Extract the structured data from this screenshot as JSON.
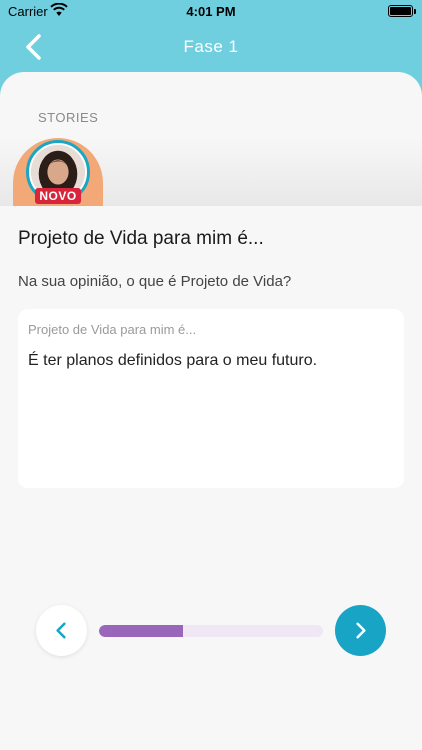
{
  "status_bar": {
    "carrier": "Carrier",
    "time": "4:01 PM"
  },
  "nav": {
    "title": "Fase 1",
    "back_icon": "chevron-left-icon"
  },
  "stories": {
    "label": "STORIES",
    "items": [
      {
        "badge": "NOVO"
      }
    ]
  },
  "question": {
    "title": "Projeto de Vida para mim é...",
    "subtitle": "Na sua opinião, o que é Projeto de Vida?"
  },
  "answer": {
    "placeholder": "Projeto de Vida para mim é...",
    "value": "É ter planos definidos para o meu futuro."
  },
  "footer": {
    "progress": 0.375,
    "prev_icon": "chevron-left-icon",
    "next_icon": "chevron-right-icon"
  },
  "colors": {
    "header": "#6fcfdf",
    "accent": "#18a4c4",
    "progress": "#9a66b9",
    "badge": "#d8253c",
    "story_bg": "#f3a877"
  }
}
